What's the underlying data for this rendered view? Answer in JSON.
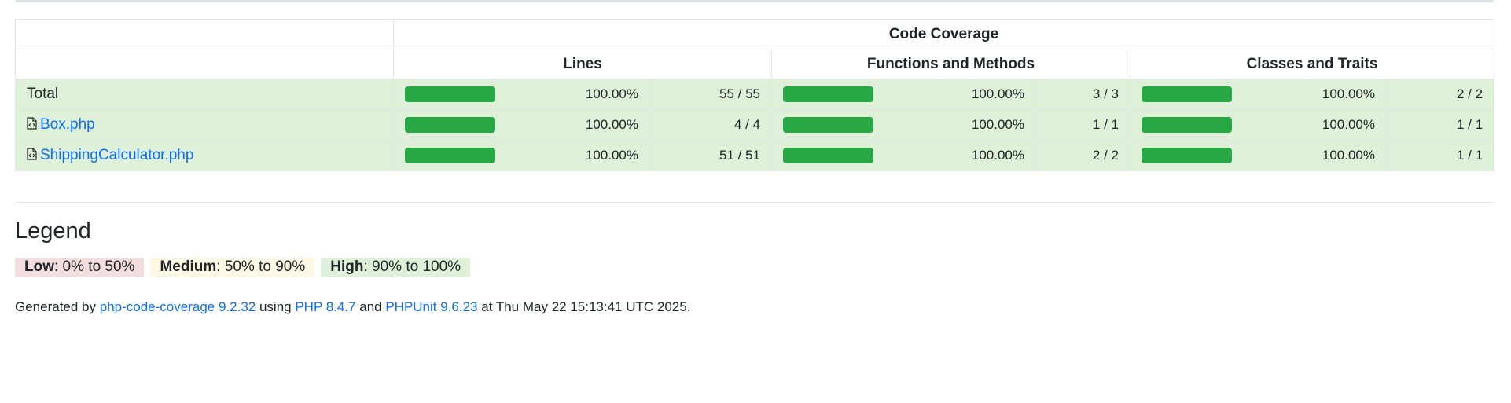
{
  "header": {
    "code_coverage": "Code Coverage",
    "lines": "Lines",
    "functions": "Functions and Methods",
    "classes": "Classes and Traits"
  },
  "rows": [
    {
      "name": "Total",
      "is_file": false,
      "lines": {
        "fill": 1.0,
        "pct": "100.00%",
        "count": "55 / 55"
      },
      "functions": {
        "fill": 1.0,
        "pct": "100.00%",
        "count": "3 / 3"
      },
      "classes": {
        "fill": 1.0,
        "pct": "100.00%",
        "count": "2 / 2"
      }
    },
    {
      "name": "Box.php",
      "is_file": true,
      "lines": {
        "fill": 1.0,
        "pct": "100.00%",
        "count": "4 / 4"
      },
      "functions": {
        "fill": 1.0,
        "pct": "100.00%",
        "count": "1 / 1"
      },
      "classes": {
        "fill": 1.0,
        "pct": "100.00%",
        "count": "1 / 1"
      }
    },
    {
      "name": "ShippingCalculator.php",
      "is_file": true,
      "lines": {
        "fill": 1.0,
        "pct": "100.00%",
        "count": "51 / 51"
      },
      "functions": {
        "fill": 1.0,
        "pct": "100.00%",
        "count": "2 / 2"
      },
      "classes": {
        "fill": 1.0,
        "pct": "100.00%",
        "count": "1 / 1"
      }
    }
  ],
  "legend": {
    "title": "Legend",
    "low_label": "Low",
    "low_range": ": 0% to 50%",
    "medium_label": "Medium",
    "medium_range": ": 50% to 90%",
    "high_label": "High",
    "high_range": ": 90% to 100%"
  },
  "footer": {
    "generated_by": "Generated by ",
    "tool_link": "php-code-coverage 9.2.32",
    "using": " using ",
    "php_link": "PHP 8.4.7",
    "and": " and ",
    "phpunit_link": "PHPUnit 9.6.23",
    "at": " at Thu May 22 15:13:41 UTC 2025."
  },
  "colors": {
    "success_bar": "#28a745",
    "high_bg": "#dff0d8",
    "medium_bg": "#fcf8e3",
    "low_bg": "#f2dede",
    "link": "#0d6efd"
  },
  "icons": {
    "file": "file-code-icon"
  }
}
